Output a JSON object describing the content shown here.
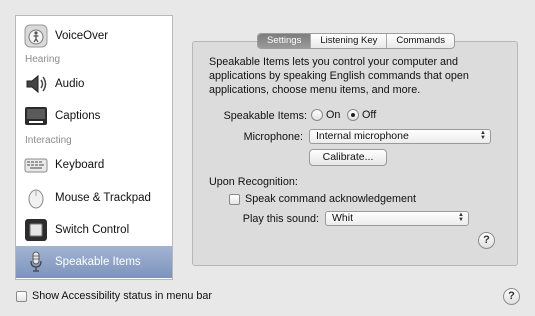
{
  "sidebar": {
    "sections": {
      "hearing": "Hearing",
      "interacting": "Interacting"
    },
    "items": [
      {
        "label": "VoiceOver",
        "icon": "voiceover-icon"
      },
      {
        "label": "Audio",
        "icon": "speaker-icon"
      },
      {
        "label": "Captions",
        "icon": "captions-icon"
      },
      {
        "label": "Keyboard",
        "icon": "keyboard-icon"
      },
      {
        "label": "Mouse & Trackpad",
        "icon": "mouse-icon"
      },
      {
        "label": "Switch Control",
        "icon": "switch-icon"
      },
      {
        "label": "Speakable Items",
        "icon": "microphone-icon",
        "selected": true
      }
    ]
  },
  "tabs": [
    {
      "label": "Settings",
      "active": true
    },
    {
      "label": "Listening Key",
      "active": false
    },
    {
      "label": "Commands",
      "active": false
    }
  ],
  "settings": {
    "description": "Speakable Items lets you control your computer and applications by speaking English commands that open applications, choose menu items, and more.",
    "speakable_items_label": "Speakable Items:",
    "on_label": "On",
    "off_label": "Off",
    "selected_state": "Off",
    "microphone_label": "Microphone:",
    "microphone_value": "Internal microphone",
    "calibrate_label": "Calibrate...",
    "upon_recognition_label": "Upon Recognition:",
    "speak_ack_label": "Speak command acknowledgement",
    "speak_ack_checked": false,
    "play_sound_label": "Play this sound:",
    "play_sound_value": "Whit"
  },
  "footer": {
    "show_status_label": "Show Accessibility status in menu bar",
    "show_status_checked": false
  },
  "help_glyph": "?",
  "colors": {
    "selection": "#7c93bc",
    "panel": "#dcdcdc",
    "window": "#e8e8e8"
  }
}
